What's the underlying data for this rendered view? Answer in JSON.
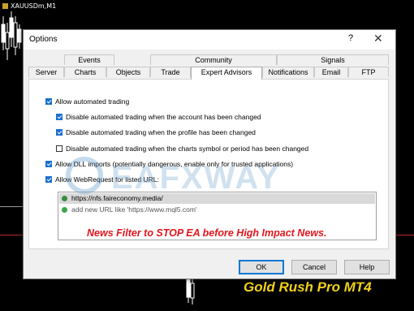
{
  "chart": {
    "symbol_title": "XAUUSDm,M1",
    "watermark": "Gold Rush Pro MT4"
  },
  "dialog": {
    "title": "Options",
    "help_glyph": "?",
    "close_glyph": "✕",
    "tabs_top": [
      "Events",
      "Community",
      "Signals"
    ],
    "tabs_bottom": [
      "Server",
      "Charts",
      "Objects",
      "Trade",
      "Expert Advisors",
      "Notifications",
      "Email",
      "FTP"
    ],
    "active_tab": "Expert Advisors",
    "options": [
      {
        "label": "Allow automated trading",
        "checked": true
      },
      {
        "label": "Disable automated trading when the account has been changed",
        "checked": true
      },
      {
        "label": "Disable automated trading when the profile has been changed",
        "checked": true
      },
      {
        "label": "Disable automated trading when the charts symbol or period has been changed",
        "checked": false
      },
      {
        "label": "Allow DLL imports (potentially dangerous, enable only for trusted applications)",
        "checked": true
      },
      {
        "label": "Allow WebRequest for listed URL:",
        "checked": true
      }
    ],
    "url_list": [
      {
        "text": "https://nfs.faireconomy.media/",
        "icon": "globe-icon"
      },
      {
        "text": "add new URL like 'https://www.mql5.com'",
        "icon": "add-icon"
      }
    ],
    "annotation": "News Filter to STOP EA before High Impact News.",
    "buttons": {
      "ok": "OK",
      "cancel": "Cancel",
      "help": "Help"
    }
  },
  "overlay_watermark": "EAFXWAY",
  "colors": {
    "accent": "#0078d7",
    "annotation": "#e1161d",
    "watermark": "#f2d21b"
  }
}
